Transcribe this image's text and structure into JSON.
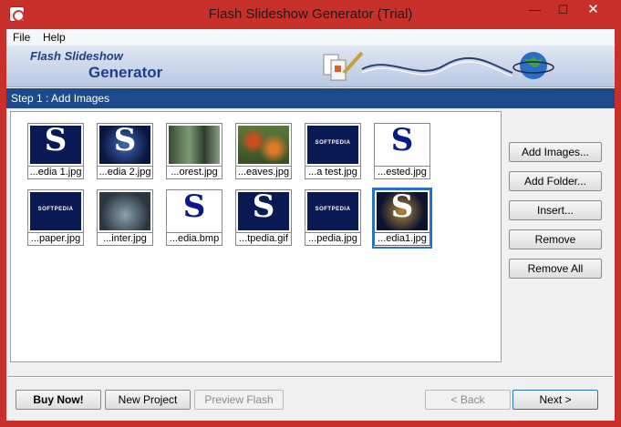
{
  "window": {
    "title": "Flash Slideshow Generator (Trial)"
  },
  "controls": {
    "minimize": "—",
    "maximize": "☐",
    "close": "✕"
  },
  "menu": {
    "file": "File",
    "help": "Help"
  },
  "banner": {
    "line1": "Flash Slideshow",
    "line2": "Generator"
  },
  "step": {
    "label": "Step 1 : Add Images"
  },
  "images": [
    {
      "caption": "...edia 1.jpg",
      "icon": "softpedia-s-icon",
      "style": "s-blue",
      "letter": "S"
    },
    {
      "caption": "...edia 2.jpg",
      "icon": "softpedia-s-icon",
      "style": "swirl",
      "letter": "S"
    },
    {
      "caption": "...orest.jpg",
      "icon": "forest-image",
      "style": "forest",
      "letter": ""
    },
    {
      "caption": "...eaves.jpg",
      "icon": "leaves-image",
      "style": "leaves",
      "letter": ""
    },
    {
      "caption": "...a test.jpg",
      "icon": "softpedia-logo",
      "style": "s-blue",
      "letter": "",
      "tag": "SOFTPEDIA"
    },
    {
      "caption": "...ested.jpg",
      "icon": "softpedia-s-icon",
      "style": "s-blue-w",
      "letter": "S"
    },
    {
      "caption": "...paper.jpg",
      "icon": "softpedia-logo",
      "style": "s-blue",
      "letter": "",
      "tag": "SOFTPEDIA"
    },
    {
      "caption": "...inter.jpg",
      "icon": "winter-image",
      "style": "winter",
      "letter": ""
    },
    {
      "caption": "...edia.bmp",
      "icon": "softpedia-s-icon",
      "style": "s-blue-w",
      "letter": "S"
    },
    {
      "caption": "...tpedia.gif",
      "icon": "softpedia-s-icon",
      "style": "s-blue",
      "letter": "S"
    },
    {
      "caption": "...pedia.jpg",
      "icon": "softpedia-logo",
      "style": "s-blue",
      "letter": "",
      "tag": "SOFTPEDIA"
    },
    {
      "caption": "...edia1.jpg",
      "icon": "sparkle-image",
      "style": "sparkle",
      "letter": "S",
      "selected": true
    }
  ],
  "side_buttons": {
    "add_images": "Add Images...",
    "add_folder": "Add Folder...",
    "insert": "Insert...",
    "remove": "Remove",
    "remove_all": "Remove All"
  },
  "bottom_buttons": {
    "buy_now": "Buy Now!",
    "new_project": "New Project",
    "preview_flash": "Preview Flash",
    "back": "< Back",
    "next": "Next >"
  }
}
